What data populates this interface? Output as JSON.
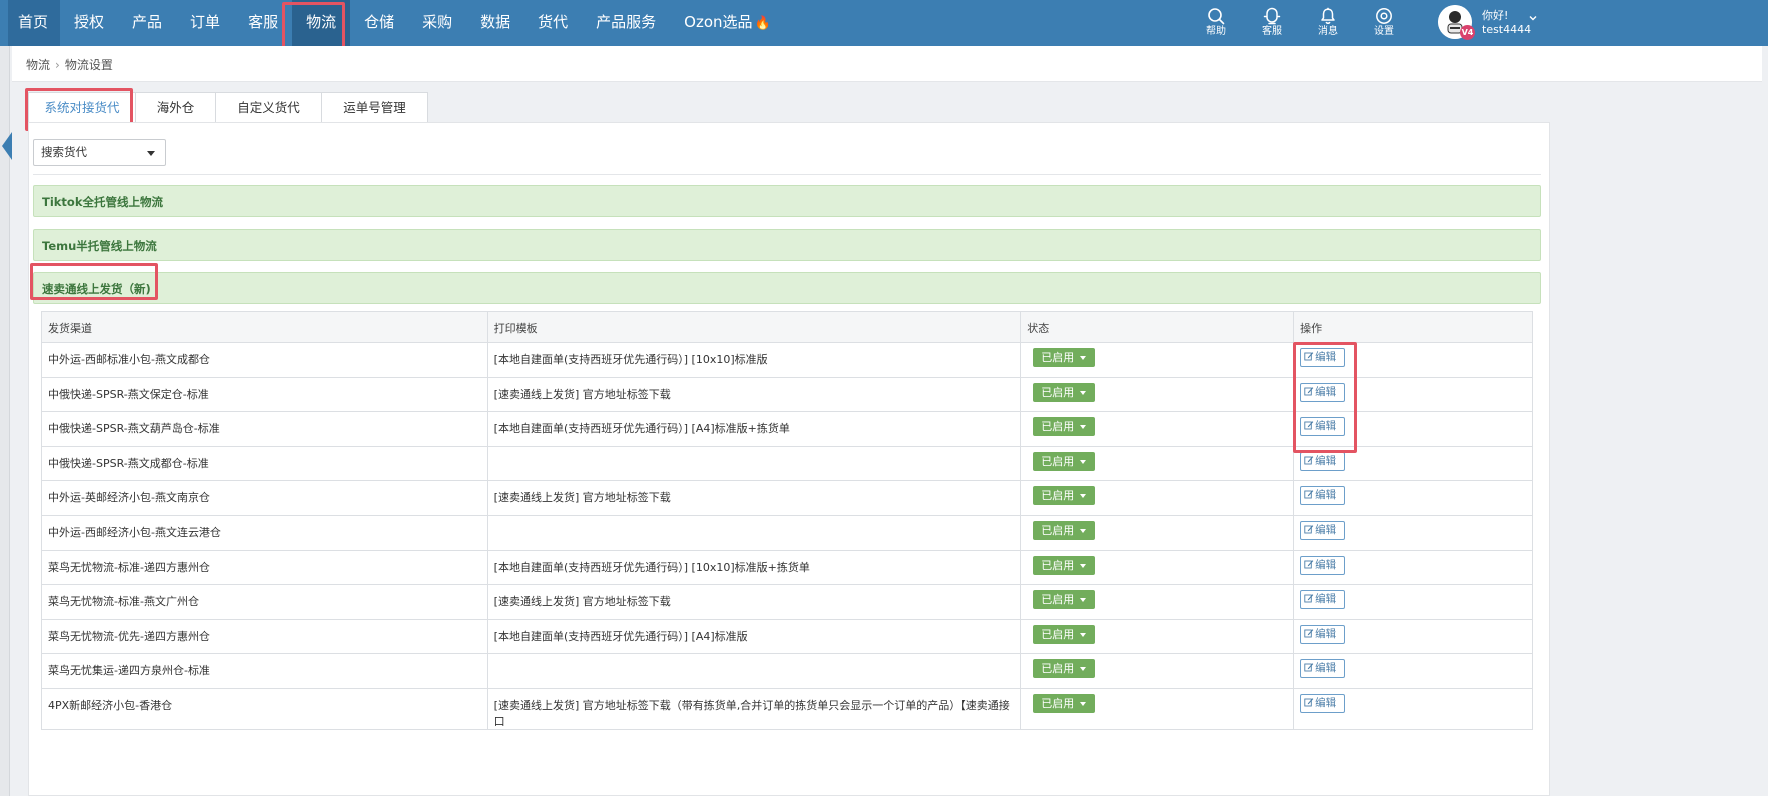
{
  "nav": {
    "items": [
      "首页",
      "授权",
      "产品",
      "订单",
      "客服",
      "物流",
      "仓储",
      "采购",
      "数据",
      "货代",
      "产品服务",
      "Ozon选品"
    ],
    "active": "物流"
  },
  "tools": [
    {
      "label": "帮助",
      "icon": "search-icon"
    },
    {
      "label": "客服",
      "icon": "support-icon"
    },
    {
      "label": "消息",
      "icon": "bell-icon"
    },
    {
      "label": "设置",
      "icon": "gear-icon"
    }
  ],
  "user": {
    "greeting": "你好!",
    "name": "test4444",
    "vip": "V4"
  },
  "breadcrumb": {
    "root": "物流",
    "current": "物流设置"
  },
  "tabs": [
    "系统对接货代",
    "海外仓",
    "自定义货代",
    "运单号管理"
  ],
  "filter": {
    "placeholder": "搜索货代"
  },
  "groups": [
    "Tiktok全托管线上物流",
    "Temu半托管线上物流",
    "速卖通线上发货（新)"
  ],
  "table": {
    "headers": [
      "发货渠道",
      "打印模板",
      "状态",
      "操作"
    ],
    "status_label": "已启用",
    "edit_label": "编辑",
    "rows": [
      {
        "channel": "中外运-西邮标准小包-燕文成都仓",
        "template": "[本地自建面单(支持西班牙优先通行码）] [10x10]标准版"
      },
      {
        "channel": "中俄快递-SPSR-燕文保定仓-标准",
        "template": "[速卖通线上发货] 官方地址标签下载"
      },
      {
        "channel": "中俄快递-SPSR-燕文葫芦岛仓-标准",
        "template": "[本地自建面单(支持西班牙优先通行码）] [A4]标准版+拣货单"
      },
      {
        "channel": "中俄快递-SPSR-燕文成都仓-标准",
        "template": ""
      },
      {
        "channel": "中外运-英邮经济小包-燕文南京仓",
        "template": "[速卖通线上发货] 官方地址标签下载"
      },
      {
        "channel": "中外运-西邮经济小包-燕文连云港仓",
        "template": ""
      },
      {
        "channel": "菜鸟无忧物流-标准-递四方惠州仓",
        "template": "[本地自建面单(支持西班牙优先通行码）] [10x10]标准版+拣货单"
      },
      {
        "channel": "菜鸟无忧物流-标准-燕文广州仓",
        "template": "[速卖通线上发货] 官方地址标签下载"
      },
      {
        "channel": "菜鸟无忧物流-优先-递四方惠州仓",
        "template": "[本地自建面单(支持西班牙优先通行码）] [A4]标准版"
      },
      {
        "channel": "菜鸟无忧集运-递四方泉州仓-标准",
        "template": ""
      },
      {
        "channel": "4PX新邮经济小包-香港仓",
        "template": "[速卖通线上发货] 官方地址标签下载（带有拣货单,合并订单的拣货单只会显示一个订单的产品）【速卖通接口"
      }
    ]
  },
  "colors": {
    "topbar": "#3c7eb2",
    "group_bg": "#dff0d8",
    "status_green": "#72ad5c",
    "highlight": "#e35462"
  }
}
